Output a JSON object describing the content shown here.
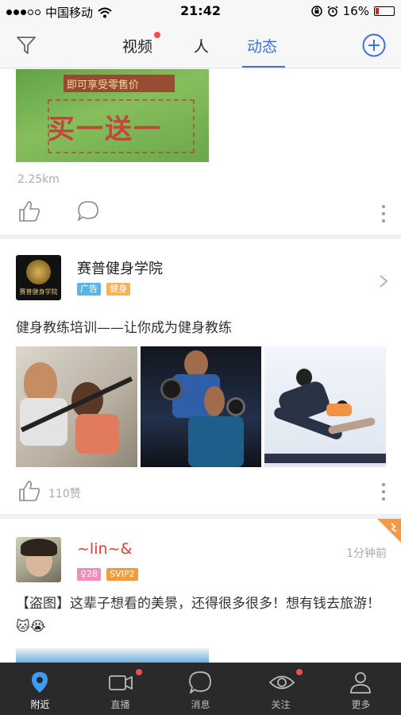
{
  "status_bar": {
    "carrier": "中国移动",
    "time": "21:42",
    "battery": "16%",
    "battery_level": 0.16
  },
  "header": {
    "tabs": [
      {
        "label": "视频",
        "active": false,
        "badge": true
      },
      {
        "label": "人",
        "active": false,
        "badge": false
      },
      {
        "label": "动态",
        "active": true,
        "badge": false
      }
    ],
    "accent": "#3d6fe0"
  },
  "feed": {
    "post1": {
      "image_text_top": "即可享受零售价",
      "image_text_main": "买一送一",
      "distance": "2.25km"
    },
    "post2": {
      "name": "赛普健身学院",
      "avatar_text": "赛普健身学院",
      "tags": [
        "广告",
        "健身"
      ],
      "text": "健身教练培训——让你成为健身教练",
      "likes": "110赞"
    },
    "post3": {
      "name": "~lin~&",
      "time": "1分钟前",
      "tags": [
        "♀28",
        "SVIP2"
      ],
      "text": "【盗图】这辈子想看的美景，还得很多很多！想有钱去旅游！🐱😭"
    }
  },
  "bottom_nav": [
    {
      "label": "附近",
      "icon": "location-pin-icon",
      "active": true,
      "badge": false
    },
    {
      "label": "直播",
      "icon": "video-camera-icon",
      "active": false,
      "badge": true
    },
    {
      "label": "消息",
      "icon": "chat-bubble-icon",
      "active": false,
      "badge": false
    },
    {
      "label": "关注",
      "icon": "eye-icon",
      "active": false,
      "badge": true
    },
    {
      "label": "更多",
      "icon": "person-icon",
      "active": false,
      "badge": false
    }
  ]
}
